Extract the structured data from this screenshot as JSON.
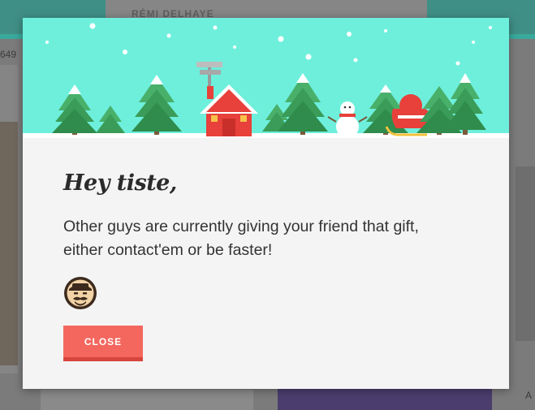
{
  "background_page": {
    "header_name": "RÉMI DELHAYE",
    "count_text": "649",
    "footer_text": "A"
  },
  "modal": {
    "title": "Hey tiste,",
    "message": "Other guys are currently giving your friend that gift, either contact'em or be faster!",
    "close_label": "CLOSE",
    "avatar_icon": "mustache-man-avatar-icon",
    "banner_icon": "winter-scene-illustration",
    "colors": {
      "banner": "#6eefdc",
      "button": "#f4675e",
      "button_shadow": "#d8453d",
      "text": "#333333"
    }
  }
}
